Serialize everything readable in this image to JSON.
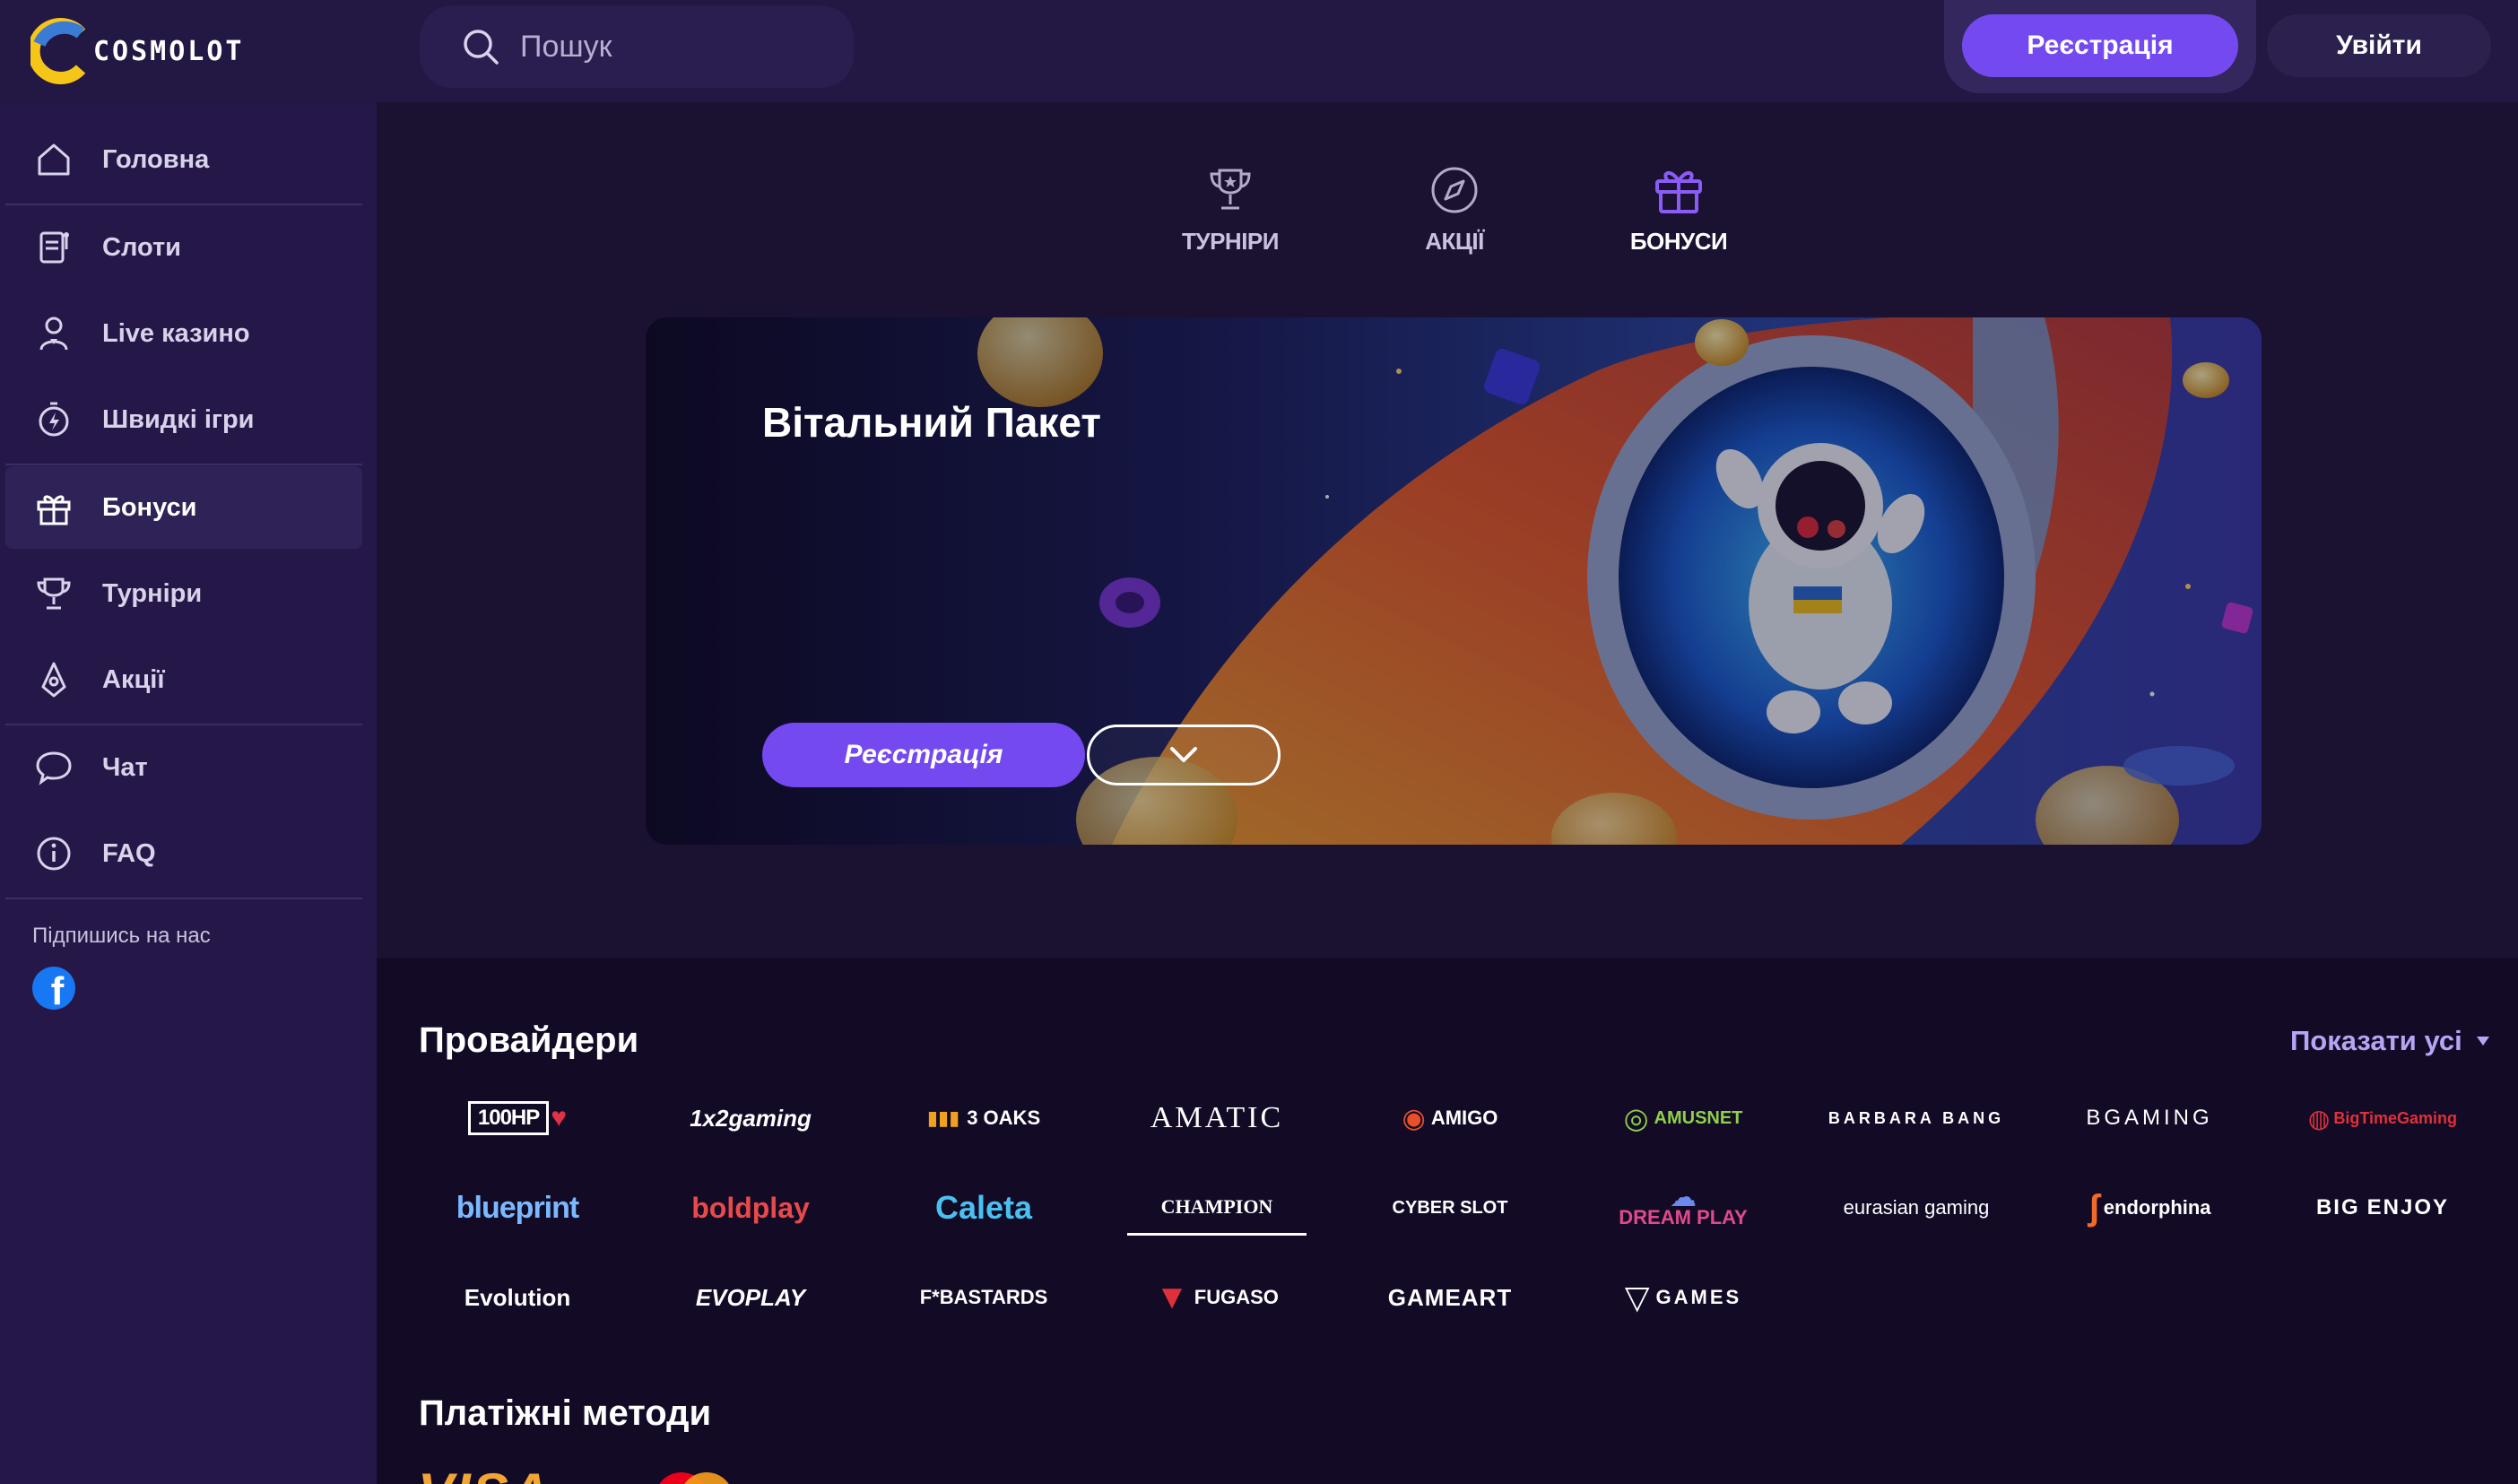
{
  "header": {
    "logo_text": "COSMOLOT",
    "search_placeholder": "Пошук",
    "register_label": "Реєстрація",
    "login_label": "Увійти"
  },
  "sidebar": {
    "items": [
      {
        "label": "Головна",
        "icon": "home-icon"
      },
      {
        "label": "Слоти",
        "icon": "slot-icon"
      },
      {
        "label": "Live казино",
        "icon": "dealer-icon"
      },
      {
        "label": "Швидкі ігри",
        "icon": "lightning-icon"
      },
      {
        "label": "Бонуси",
        "icon": "gift-icon",
        "active": true
      },
      {
        "label": "Турніри",
        "icon": "trophy-icon"
      },
      {
        "label": "Акції",
        "icon": "rocket-icon"
      },
      {
        "label": "Чат",
        "icon": "chat-icon"
      },
      {
        "label": "FAQ",
        "icon": "info-icon"
      }
    ],
    "subscribe_label": "Підпишись на нас",
    "social_icon": "facebook-icon"
  },
  "tabs": [
    {
      "label": "ТУРНІРИ",
      "icon": "trophy-icon"
    },
    {
      "label": "АКЦІЇ",
      "icon": "compass-icon"
    },
    {
      "label": "БОНУСИ",
      "icon": "gift-icon",
      "active": true
    }
  ],
  "banner": {
    "title": "Вітальний Пакет",
    "register_label": "Реєстрація",
    "expand_icon": "chevron-down-icon"
  },
  "providers": {
    "title": "Провайдери",
    "show_all_label": "Показати усі",
    "items": [
      "100HP",
      "1x2gaming",
      "3 OAKS",
      "AMATIC",
      "AMIGO",
      "AMUSNET",
      "BARBARA BANG",
      "BGAMING",
      "BigTimeGaming",
      "blueprint",
      "boldplay",
      "Caleta",
      "CHAMPION",
      "CYBER SLOT",
      "DREAM PLAY",
      "eurasian gaming",
      "endorphina",
      "ENJOY",
      "Evolution",
      "EVOPLAY",
      "F*BASTARDS",
      "FUGASO",
      "GAMEART",
      "GAMES"
    ]
  },
  "payments": {
    "title": "Платіжні методи",
    "items": [
      "VISA",
      "Mastercard"
    ]
  },
  "colors": {
    "accent": "#7449f0",
    "sidebar_bg": "#251848",
    "main_bg": "#1b1232",
    "show_all": "#b8a4f5"
  }
}
